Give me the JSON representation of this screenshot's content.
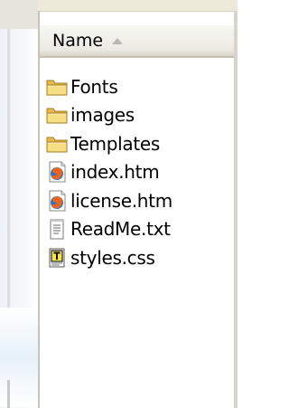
{
  "window": {
    "colors": {
      "background": "#ffffff",
      "header_bg": "#ebeae2",
      "folder_fill": "#f4d676",
      "browser_blue": "#3a6fc8",
      "browser_orange": "#e8651a"
    }
  },
  "file_list": {
    "column_header": "Name",
    "sort": "ascending",
    "items": [
      {
        "name": "Fonts",
        "type": "folder",
        "icon": "folder-icon"
      },
      {
        "name": "images",
        "type": "folder",
        "icon": "folder-icon"
      },
      {
        "name": "Templates",
        "type": "folder",
        "icon": "folder-icon"
      },
      {
        "name": "index.htm",
        "type": "html",
        "icon": "firefox-html-file-icon"
      },
      {
        "name": "license.htm",
        "type": "html",
        "icon": "firefox-html-file-icon"
      },
      {
        "name": "ReadMe.txt",
        "type": "text",
        "icon": "text-file-icon"
      },
      {
        "name": "styles.css",
        "type": "css",
        "icon": "css-file-icon"
      }
    ]
  }
}
